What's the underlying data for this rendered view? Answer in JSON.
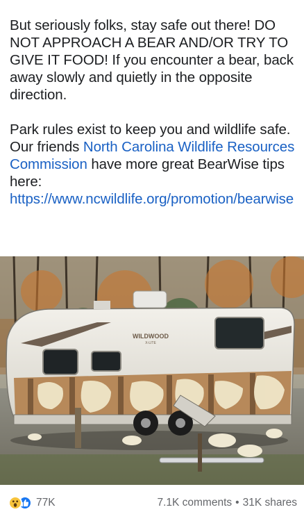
{
  "post": {
    "para1": "But seriously folks, stay safe out there! DO NOT APPROACH A BEAR AND/OR TRY TO GIVE IT FOOD! If you encounter a bear, back away slowly and quietly in the opposite direction.",
    "para2_start": "Park rules exist to keep you and wildlife safe. Our friends ",
    "para2_link": "North Carolina Wildlife Resources Commission",
    "para2_mid": " have more great BearWise tips here: ",
    "para2_url": "https://www.ncwildlife.org/promotion/bearwise"
  },
  "photo": {
    "trailer_brand": "WILDWOOD",
    "trailer_model": "X-LITE"
  },
  "footer": {
    "reaction_count": "77K",
    "comments": "7.1K comments",
    "separator": "•",
    "shares": "31K shares"
  },
  "colors": {
    "link": "#1a61c4",
    "like": "#1877f2",
    "wow": "#f7c33b"
  },
  "icons": {
    "reaction_1": "wow-reaction-icon",
    "reaction_2": "like-reaction-icon"
  }
}
